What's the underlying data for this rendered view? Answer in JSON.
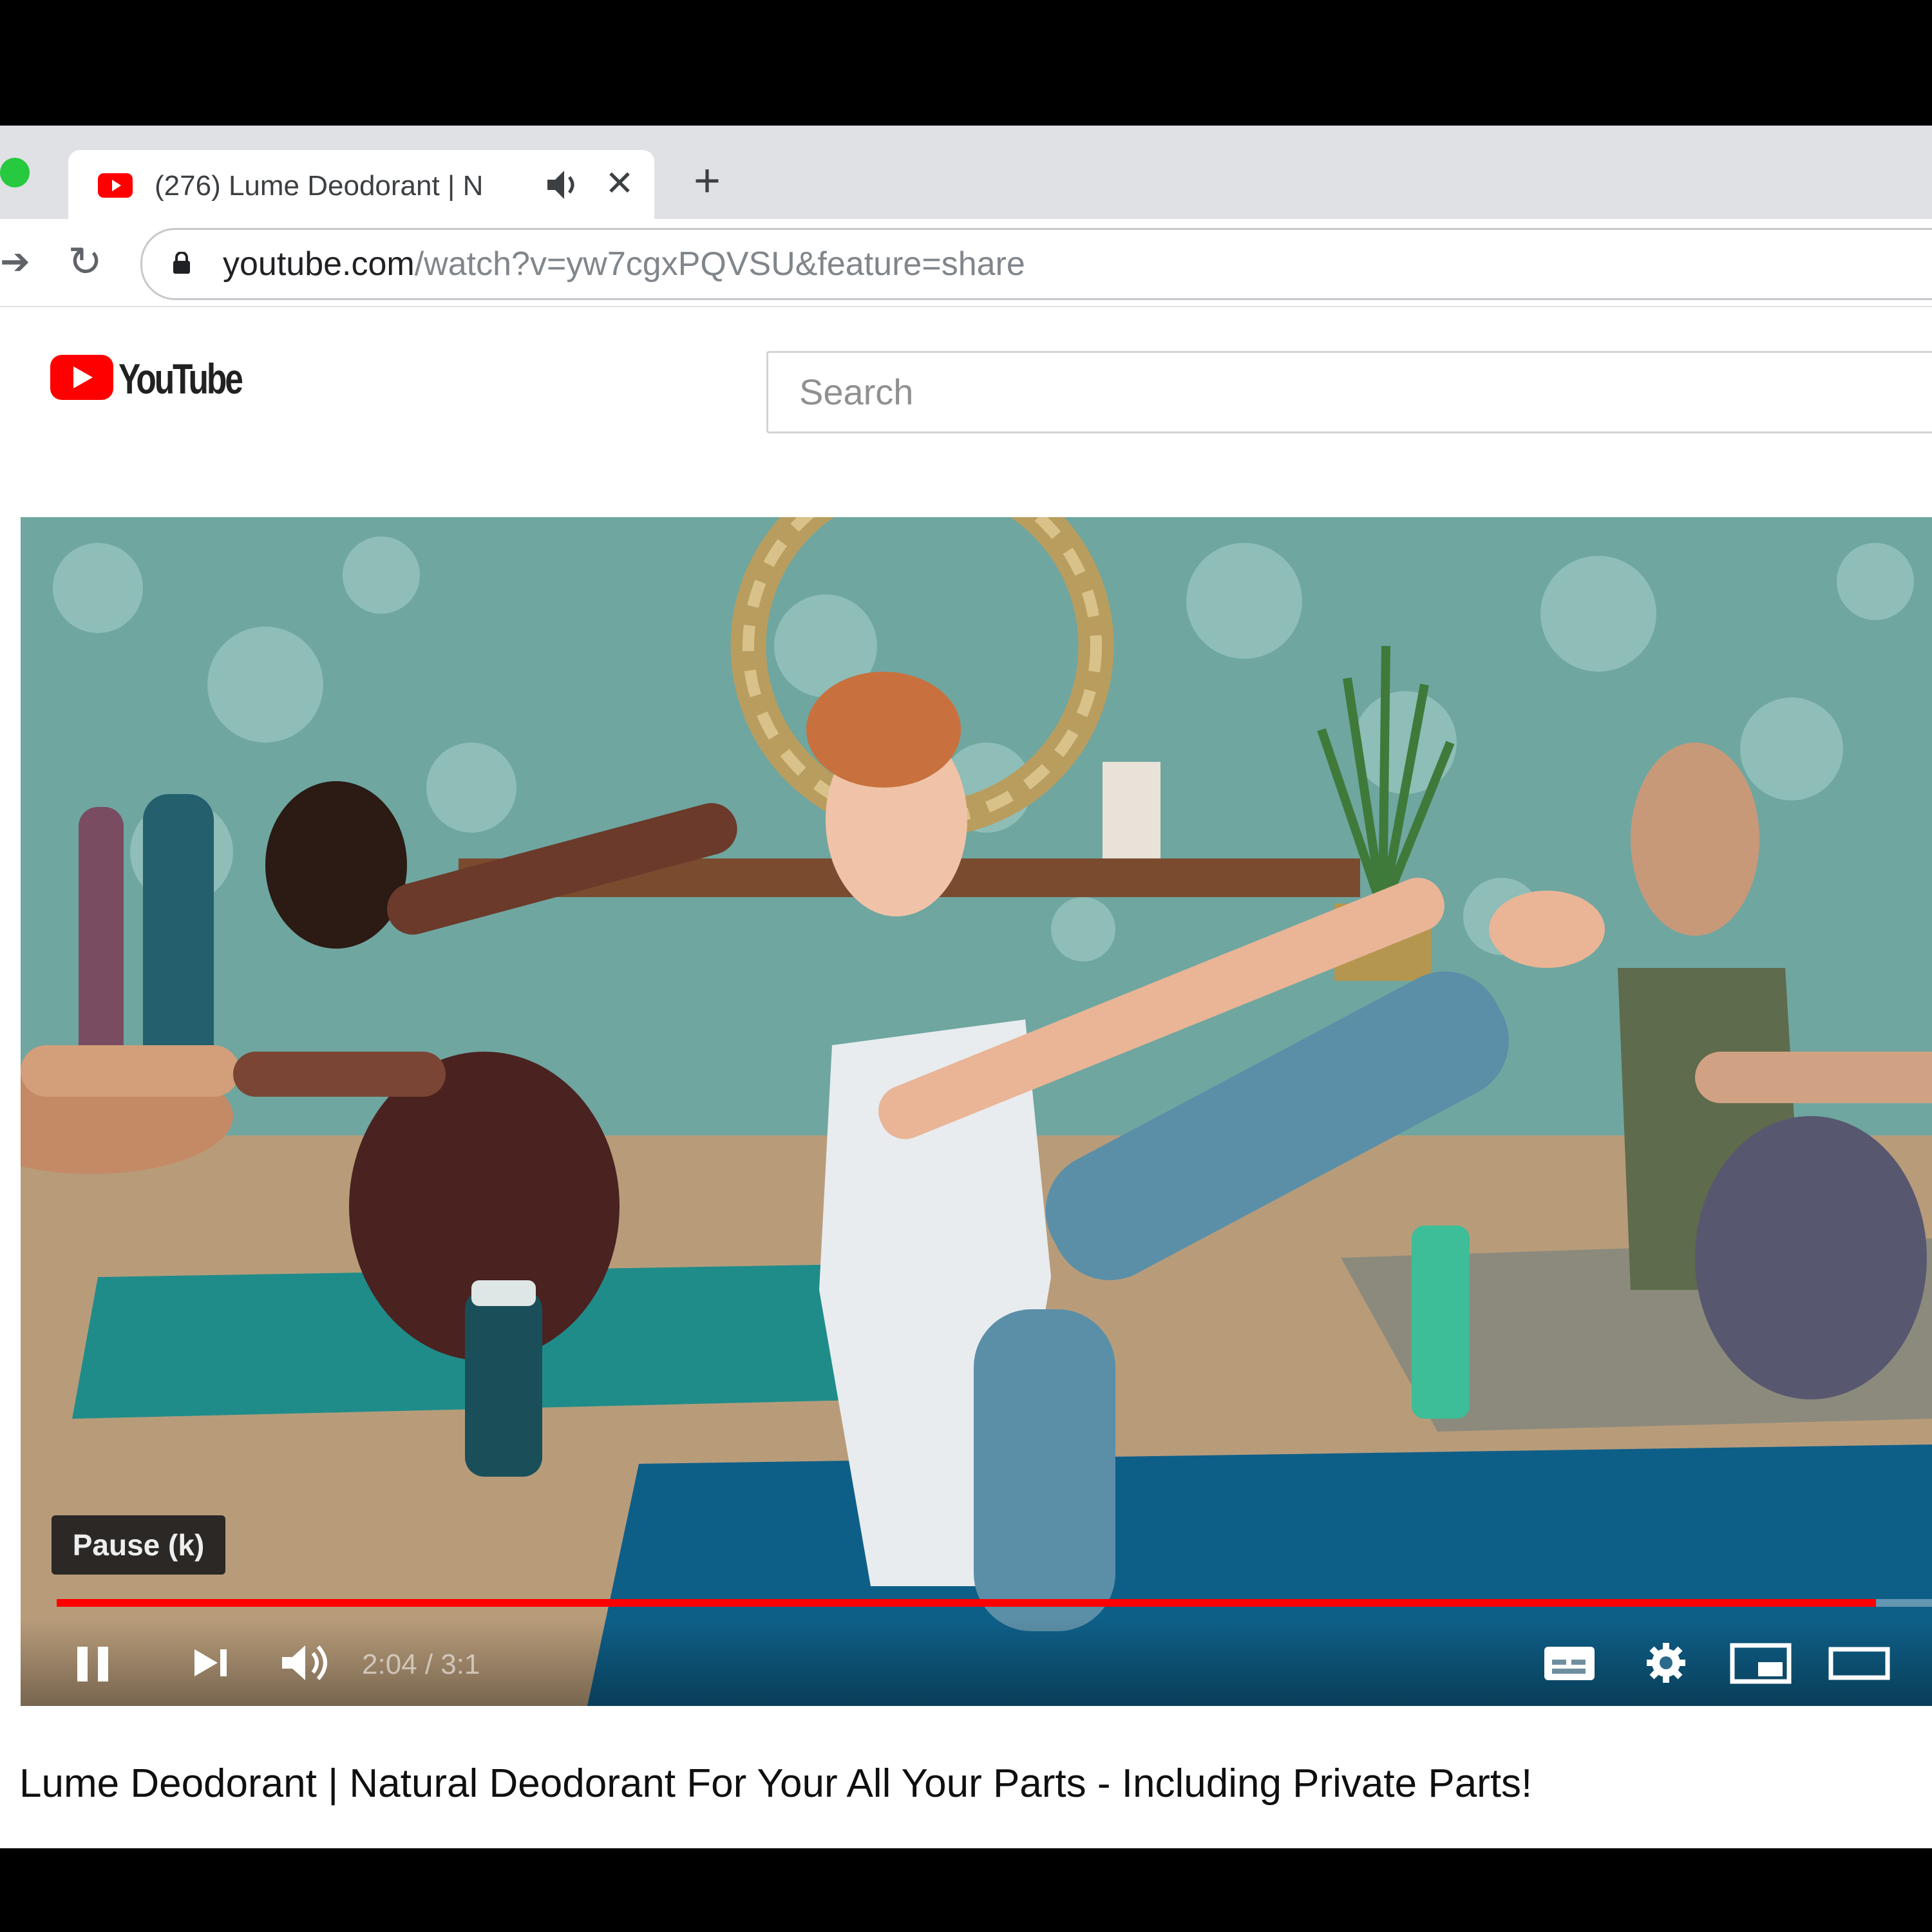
{
  "browser": {
    "tab": {
      "title": "(276) Lume Deodorant | N"
    },
    "address_bar": {
      "domain": "youtube.com",
      "path": "/watch?v=yw7cgxPQVSU&feature=share"
    }
  },
  "youtube": {
    "logo_text": "YouTube",
    "search_placeholder": "Search"
  },
  "player": {
    "tooltip": "Pause (k)",
    "time_display": "2:04 / 3:1",
    "progress_fraction": 0.97
  },
  "video": {
    "title": "Lume Deodorant | Natural Deodorant For Your All Your Parts - Including Private Parts!"
  },
  "colors": {
    "youtube_red": "#ff0000",
    "progress_red": "#ff0000",
    "wallpaper_teal": "#6fa6a0",
    "mat_blue": "#0e5f88"
  },
  "icons": [
    "close-icon",
    "plus-icon",
    "audio-icon",
    "reload-icon",
    "lock-icon",
    "play-pause-icon",
    "next-icon",
    "volume-icon",
    "subtitles-icon",
    "settings-icon",
    "miniplayer-icon",
    "theater-icon"
  ]
}
